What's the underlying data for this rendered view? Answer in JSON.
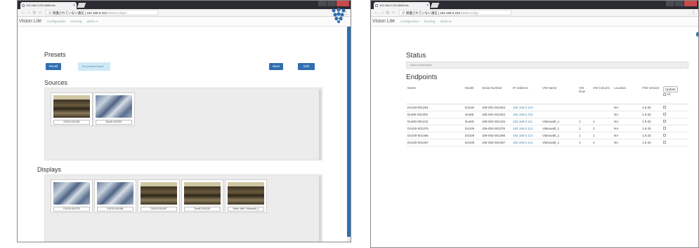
{
  "left": {
    "tab_title": "192.168.0.223:8080/vis",
    "url_host": "⊙ 保護されていない通信 | 192.168.0.223",
    "url_path": ":8080/config/1",
    "brand": "Vision Lite",
    "menu": [
      "Configuration",
      "Routing",
      "admin ▾"
    ],
    "presets_title": "Presets",
    "recall_label": "Recall",
    "no_presets_text": "No presets found",
    "save_label": "Save",
    "edit_label": "Edit",
    "sources_title": "Sources",
    "sources": [
      {
        "label": "E4100-001264",
        "thumb": "land"
      },
      {
        "label": "DuetD-001302",
        "thumb": "city"
      }
    ],
    "displays_title": "Displays",
    "displays": [
      {
        "label": "D4100-001376",
        "thumb": "city"
      },
      {
        "label": "E4100-001466",
        "thumb": "city"
      },
      {
        "label": "D4100-001467",
        "thumb": "land"
      },
      {
        "label": "DuetD-001415",
        "thumb": "land"
      },
      {
        "label": "Video Wall: Videowall_1",
        "thumb": "land"
      }
    ]
  },
  "right": {
    "tab_title": "192.168.0.223:8080/vis",
    "url_host": "⊙ 保護されていない通信 | 192.168.0.223",
    "url_path": ":8080/config/",
    "brand": "Vision Lite",
    "menu": [
      "Configuration",
      "Routing",
      "admin ▾"
    ],
    "status_title": "Status",
    "status_info": "Status information",
    "endpoints_title": "Endpoints",
    "columns": {
      "name": "Name",
      "model": "Model",
      "serial": "Serial Number",
      "ip": "IP Address",
      "vw_name": "VW Name",
      "vw_row": "VW Row",
      "vw_col": "VW Column",
      "location": "Location",
      "fw": "F/W Version",
      "update": "Update",
      "all": "All"
    },
    "rows": [
      {
        "name": "E4100-001264",
        "model": "E4100",
        "serial": "106-001-001264",
        "ip": "192.168.0.102",
        "vw_name": "",
        "vw_row": "",
        "vw_col": "",
        "location": "NA",
        "fw": "1.9.33"
      },
      {
        "name": "DuetE-001302",
        "model": "DuetE",
        "serial": "106-001-001302",
        "ip": "192.168.0.101",
        "vw_name": "",
        "vw_row": "",
        "vw_col": "",
        "location": "NA",
        "fw": "1.9.33"
      },
      {
        "name": "DuetD-001415",
        "model": "DuetD",
        "serial": "106-002-001415",
        "ip": "192.168.0.111",
        "vw_name": "Videowall_1",
        "vw_row": "1",
        "vw_col": "1",
        "location": "NA",
        "fw": "1.9.33"
      },
      {
        "name": "D4100-001376",
        "model": "D4100",
        "serial": "106-002-001376",
        "ip": "192.168.0.112",
        "vw_name": "Videowall_1",
        "vw_row": "1",
        "vw_col": "2",
        "location": "NA",
        "fw": "1.9.33"
      },
      {
        "name": "D4100-001466",
        "model": "D4100",
        "serial": "106-002-001466",
        "ip": "192.168.0.113",
        "vw_name": "Videowall_1",
        "vw_row": "1",
        "vw_col": "1",
        "location": "NA",
        "fw": "1.9.33"
      },
      {
        "name": "D4100-001467",
        "model": "D4100",
        "serial": "106-002-001467",
        "ip": "192.168.0.114",
        "vw_name": "Videowall_1",
        "vw_row": "1",
        "vw_col": "2",
        "location": "NA",
        "fw": "1.9.33"
      }
    ]
  },
  "colors": {
    "primary": "#2f6fb0",
    "info_bg": "#cfe9f5",
    "panel_bg": "#ececec",
    "tab_bar": "#2b2b33"
  }
}
